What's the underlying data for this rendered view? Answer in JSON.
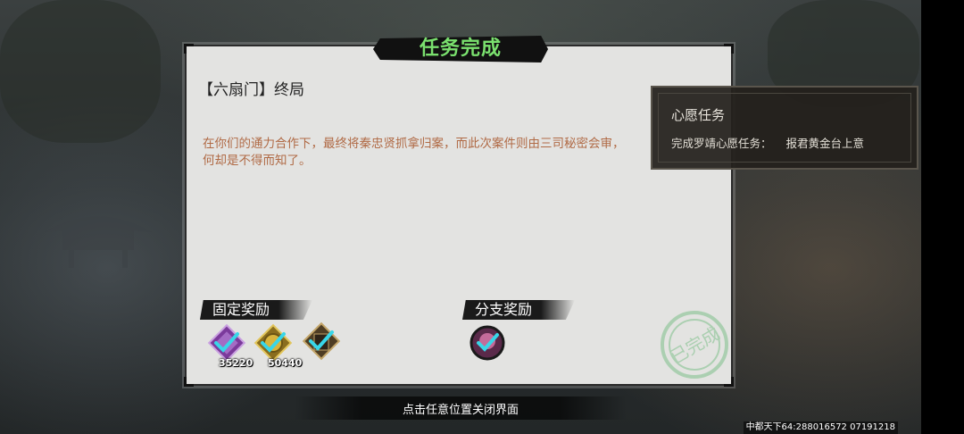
{
  "dialog": {
    "title": "任务完成",
    "quest_name": "【六扇门】终局",
    "description": "在你们的通力合作下，最终将秦忠贤抓拿归案，而此次案件则由三司秘密会审，\n何却是不得而知了。",
    "fixed_reward_label": "固定奖励",
    "branch_reward_label": "分支奖励",
    "fixed_rewards": [
      {
        "icon": "purple-gem-icon",
        "count": "35220",
        "checked": true
      },
      {
        "icon": "gold-coin-icon",
        "count": "50440",
        "checked": true
      },
      {
        "icon": "book-icon",
        "count": "",
        "checked": true
      }
    ],
    "branch_rewards": [
      {
        "icon": "character-token-icon",
        "count": "",
        "checked": true
      }
    ],
    "stamp_text": "已完成"
  },
  "wish_panel": {
    "title": "心愿任务",
    "row_label": "完成罗靖心愿任务：",
    "row_value": "报君黄金台上意"
  },
  "close_hint": "点击任意位置关闭界面",
  "server_info": "中都天下64:288016572  07191218",
  "colors": {
    "title_green": "#7ae06e",
    "description_orange": "#b06a45",
    "check_cyan": "#38d6e8"
  }
}
